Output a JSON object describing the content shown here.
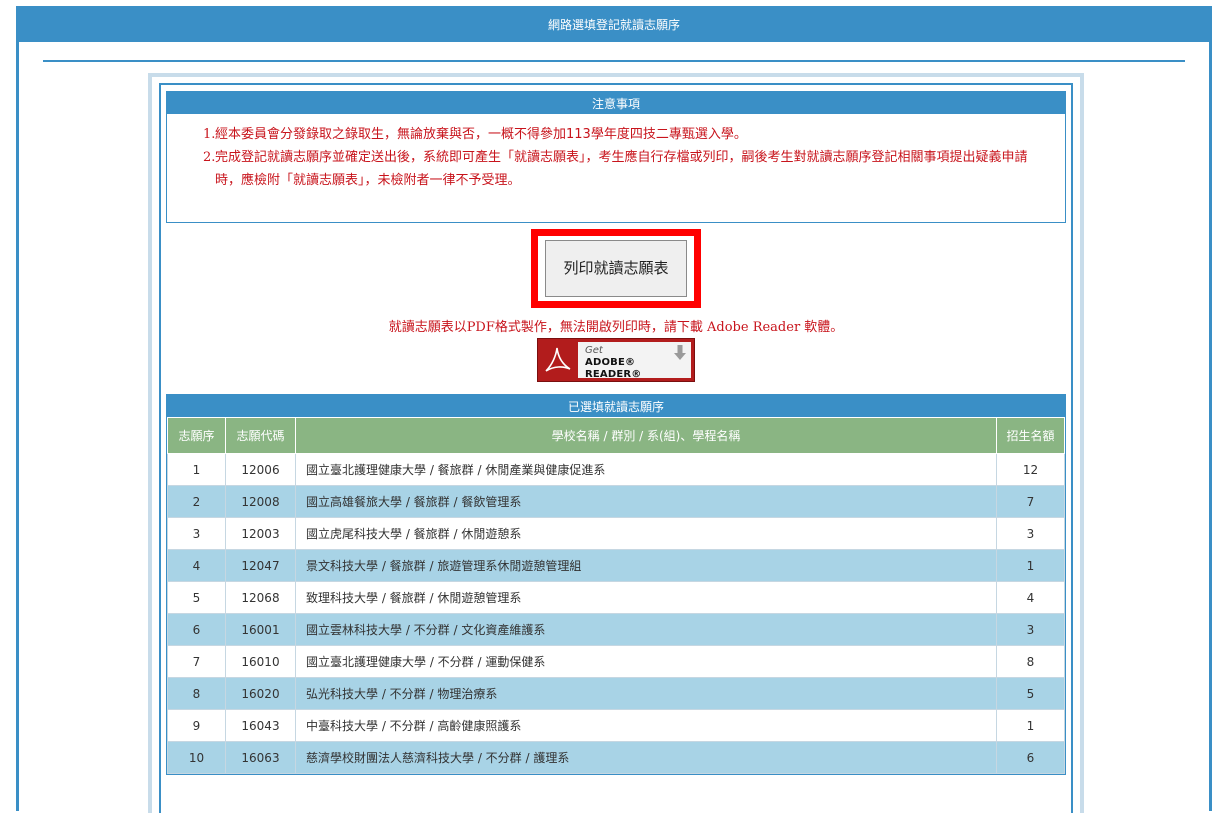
{
  "header": {
    "title": "網路選填登記就讀志願序"
  },
  "notice": {
    "title": "注意事項",
    "items": [
      {
        "num": "1.",
        "text": "經本委員會分發錄取之錄取生，無論放棄與否，一概不得參加113學年度四技二專甄選入學。"
      },
      {
        "num": "2.",
        "text": "完成登記就讀志願序並確定送出後，系統即可產生「就讀志願表」，考生應自行存檔或列印，嗣後考生對就讀志願序登記相關事項提出疑義申請時，應檢附「就讀志願表」，未檢附者一律不予受理。"
      }
    ]
  },
  "print_button": {
    "label": "列印就讀志願表"
  },
  "pdf_note": "就讀志願表以PDF格式製作，無法開啟列印時，請下載 Adobe Reader 軟體。",
  "adobe_badge": {
    "get": "Get",
    "name": "ADOBE® READER®"
  },
  "chosen": {
    "title": "已選填就讀志願序",
    "columns": [
      "志願序",
      "志願代碼",
      "學校名稱 / 群別 / 系(組)、學程名稱",
      "招生名額"
    ],
    "rows": [
      {
        "order": "1",
        "code": "12006",
        "name": "國立臺北護理健康大學 / 餐旅群 / 休閒產業與健康促進系",
        "quota": "12"
      },
      {
        "order": "2",
        "code": "12008",
        "name": "國立高雄餐旅大學 / 餐旅群 / 餐飲管理系",
        "quota": "7"
      },
      {
        "order": "3",
        "code": "12003",
        "name": "國立虎尾科技大學 / 餐旅群 / 休閒遊憩系",
        "quota": "3"
      },
      {
        "order": "4",
        "code": "12047",
        "name": "景文科技大學 / 餐旅群 / 旅遊管理系休閒遊憩管理組",
        "quota": "1"
      },
      {
        "order": "5",
        "code": "12068",
        "name": "致理科技大學 / 餐旅群 / 休閒遊憩管理系",
        "quota": "4"
      },
      {
        "order": "6",
        "code": "16001",
        "name": "國立雲林科技大學 / 不分群 / 文化資產維護系",
        "quota": "3"
      },
      {
        "order": "7",
        "code": "16010",
        "name": "國立臺北護理健康大學 / 不分群 / 運動保健系",
        "quota": "8"
      },
      {
        "order": "8",
        "code": "16020",
        "name": "弘光科技大學 / 不分群 / 物理治療系",
        "quota": "5"
      },
      {
        "order": "9",
        "code": "16043",
        "name": "中臺科技大學 / 不分群 / 高齡健康照護系",
        "quota": "1"
      },
      {
        "order": "10",
        "code": "16063",
        "name": "慈濟學校財團法人慈濟科技大學 / 不分群 / 護理系",
        "quota": "6"
      }
    ]
  },
  "colors": {
    "header_blue": "#3a8fc6",
    "table_header_green": "#8ab583",
    "row_blue": "#a8d3e6",
    "notice_red": "#c8141c",
    "highlight_red": "#ff0000",
    "adobe_red": "#b21c1c"
  }
}
